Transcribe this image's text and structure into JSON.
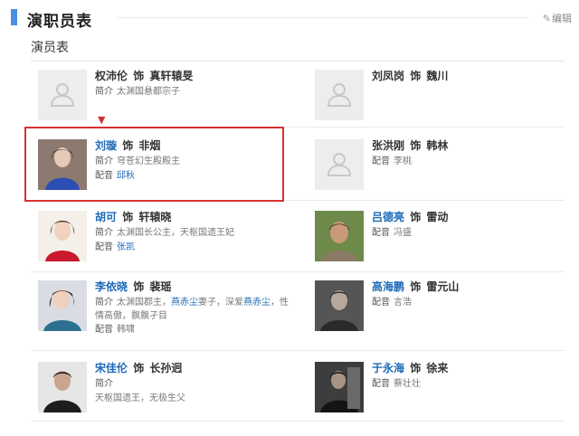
{
  "section": {
    "title": "演职员表",
    "edit_label": "编辑"
  },
  "subsection": {
    "title": "演员表"
  },
  "labels": {
    "role_sep": "饰",
    "intro": "简介",
    "dub": "配音"
  },
  "cast": [
    {
      "actor": "权沛伦",
      "role": "真轩辕旻",
      "intro": "太渊国悬都宗子",
      "dub": "",
      "has_photo": false,
      "actor_link": false
    },
    {
      "actor": "刘凤岗",
      "role": "魏川",
      "intro": "",
      "dub": "",
      "has_photo": false,
      "actor_link": false
    },
    {
      "actor": "刘璇",
      "role": "非烟",
      "intro": "穹苍幻生殿殿主",
      "dub": "邱秋",
      "has_photo": true,
      "actor_link": true
    },
    {
      "actor": "张洪刚",
      "role": "韩林",
      "intro": "",
      "dub": "李桃",
      "has_photo": false,
      "actor_link": false
    },
    {
      "actor": "胡可",
      "role": "轩辕晓",
      "intro": "太渊国长公主，天枢国遗王妃",
      "dub": "张凯",
      "has_photo": true,
      "actor_link": true
    },
    {
      "actor": "吕德亮",
      "role": "雷动",
      "intro": "",
      "dub": "冯盛",
      "has_photo": true,
      "actor_link": true
    },
    {
      "actor": "李依晓",
      "role": "裴瑶",
      "intro_parts": [
        "太渊国郡主，",
        "燕赤尘",
        "妻子，深爱",
        "燕赤尘",
        "，性情高傲，飘飘孑目"
      ],
      "dub": "韩啸",
      "has_photo": true,
      "actor_link": true
    },
    {
      "actor": "高海鹏",
      "role": "雷元山",
      "intro": "",
      "dub": "言浩",
      "has_photo": true,
      "actor_link": true
    },
    {
      "actor": "宋佳伦",
      "role": "长孙迥",
      "intro": "",
      "extra": "天枢国遗王，无极生父",
      "dub": "",
      "has_photo": true,
      "actor_link": true
    },
    {
      "actor": "于永海",
      "role": "徐来",
      "intro": "",
      "dub": "蔡壮壮",
      "has_photo": true,
      "actor_link": true
    }
  ]
}
